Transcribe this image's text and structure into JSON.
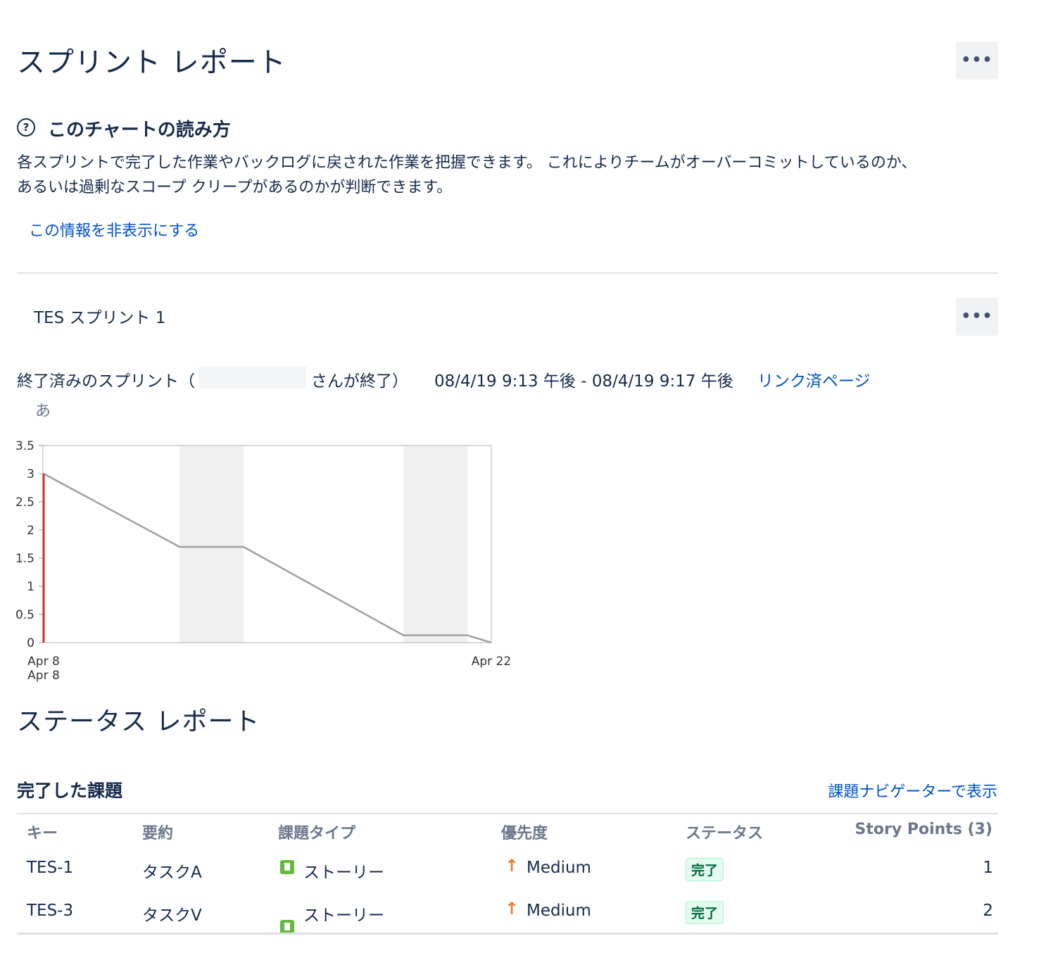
{
  "page": {
    "title": "スプリント レポート"
  },
  "help": {
    "heading": "このチャートの読み方",
    "line1": "各スプリントで完了した作業やバックログに戻された作業を把握できます。 これによりチームがオーバーコミットしているのか、",
    "line2": "あるいは過剰なスコープ クリープがあるのかが判断できます。",
    "hide_link": "この情報を非表示にする"
  },
  "sprint": {
    "name": "TES スプリント 1",
    "ended_prefix": "終了済みのスプリント（",
    "ended_suffix": "さんが終了）",
    "date_range": "08/4/19 9:13 午後 - 08/4/19 9:17 午後",
    "linked_pages": "リンク済ページ",
    "legend_char": "あ"
  },
  "chart_data": {
    "type": "line",
    "y_ticks": [
      "3.5",
      "3",
      "2.5",
      "2",
      "1.5",
      "1",
      "0.5",
      "0"
    ],
    "ylim": [
      0,
      3.5
    ],
    "x_tick_labels": [
      "Apr 8",
      "Apr 22"
    ],
    "x_sub_label": "Apr 8",
    "x_range": [
      0,
      14
    ],
    "nonworking_bands": [
      [
        4.25,
        6.25
      ],
      [
        11.25,
        13.25
      ]
    ],
    "series": [
      {
        "color": "#a0a0a0",
        "points": [
          [
            0,
            3
          ],
          [
            4.25,
            1.7
          ],
          [
            6.25,
            1.7
          ],
          [
            11.25,
            0.13
          ],
          [
            13.25,
            0.13
          ],
          [
            14,
            0
          ]
        ]
      },
      {
        "color": "#c8372d",
        "points": [
          [
            0,
            0
          ],
          [
            0,
            3
          ]
        ]
      }
    ],
    "grid": false
  },
  "status_report": {
    "title": "ステータス レポート"
  },
  "completed": {
    "heading": "完了した課題",
    "nav_link": "課題ナビゲーターで表示",
    "columns": [
      "キー",
      "要約",
      "課題タイプ",
      "優先度",
      "ステータス",
      "Story Points (3)"
    ],
    "rows": [
      {
        "key": "TES-1",
        "summary": "タスクA",
        "type": "ストーリー",
        "priority": "Medium",
        "status": "完了",
        "points": "1"
      },
      {
        "key": "TES-3",
        "summary": "タスクV",
        "type": "ストーリー",
        "priority": "Medium",
        "status": "完了",
        "points": "2"
      }
    ]
  },
  "icons": {
    "more": "ellipsis-icon",
    "help": "question-circle-icon",
    "story": "story-icon",
    "priority": "arrow-up-icon"
  },
  "colors": {
    "link": "#0052cc",
    "text": "#172b4d",
    "done_green": "#006644",
    "story_green": "#63ba3c",
    "priority_orange": "#e97f33"
  }
}
